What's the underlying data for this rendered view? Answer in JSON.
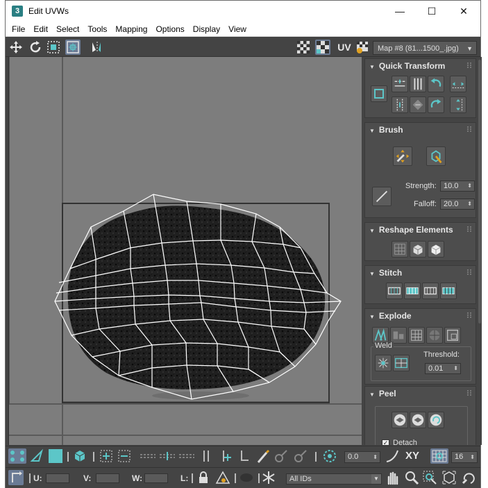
{
  "window": {
    "title": "Edit UVWs",
    "app_icon_glyph": "3",
    "minimize_glyph": "—",
    "maximize_glyph": "☐",
    "close_glyph": "✕"
  },
  "menu": [
    "File",
    "Edit",
    "Select",
    "Tools",
    "Mapping",
    "Options",
    "Display",
    "View"
  ],
  "toolbar": {
    "uv_label": "UV",
    "map_select_value": "Map #8 (81...1500_.jpg)"
  },
  "panel": {
    "quick_transform": {
      "title": "Quick Transform"
    },
    "brush": {
      "title": "Brush",
      "strength_label": "Strength:",
      "strength_value": "10.0",
      "falloff_label": "Falloff:",
      "falloff_value": "20.0"
    },
    "reshape": {
      "title": "Reshape Elements"
    },
    "stitch": {
      "title": "Stitch"
    },
    "explode": {
      "title": "Explode",
      "weld_label": "Weld",
      "threshold_label": "Threshold:",
      "threshold_value": "0.01"
    },
    "peel": {
      "title": "Peel",
      "detach_label": "Detach",
      "detach_checked": true
    }
  },
  "bottom1": {
    "angle_value": "0.0",
    "xy_label": "XY",
    "grid_value": "16"
  },
  "bottom2": {
    "u_label": "U:",
    "v_label": "V:",
    "w_label": "W:",
    "l_label": "L:",
    "ids_value": "All IDs"
  },
  "colors": {
    "accent": "#5cc6c8",
    "panel_bg": "#444444",
    "viewport_bg": "#7d7d7d",
    "texture": "#1e1e1e"
  }
}
